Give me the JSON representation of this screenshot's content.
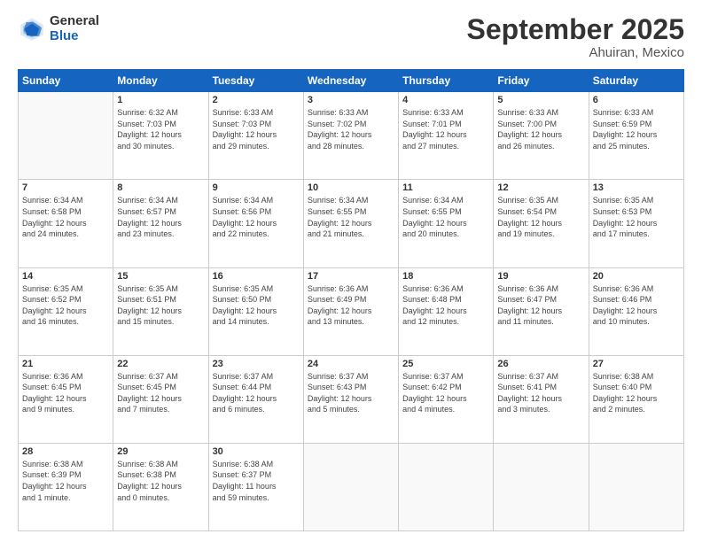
{
  "logo": {
    "general": "General",
    "blue": "Blue"
  },
  "title": {
    "month": "September 2025",
    "location": "Ahuiran, Mexico"
  },
  "days_header": [
    "Sunday",
    "Monday",
    "Tuesday",
    "Wednesday",
    "Thursday",
    "Friday",
    "Saturday"
  ],
  "weeks": [
    [
      {
        "day": "",
        "info": ""
      },
      {
        "day": "1",
        "info": "Sunrise: 6:32 AM\nSunset: 7:03 PM\nDaylight: 12 hours\nand 30 minutes."
      },
      {
        "day": "2",
        "info": "Sunrise: 6:33 AM\nSunset: 7:03 PM\nDaylight: 12 hours\nand 29 minutes."
      },
      {
        "day": "3",
        "info": "Sunrise: 6:33 AM\nSunset: 7:02 PM\nDaylight: 12 hours\nand 28 minutes."
      },
      {
        "day": "4",
        "info": "Sunrise: 6:33 AM\nSunset: 7:01 PM\nDaylight: 12 hours\nand 27 minutes."
      },
      {
        "day": "5",
        "info": "Sunrise: 6:33 AM\nSunset: 7:00 PM\nDaylight: 12 hours\nand 26 minutes."
      },
      {
        "day": "6",
        "info": "Sunrise: 6:33 AM\nSunset: 6:59 PM\nDaylight: 12 hours\nand 25 minutes."
      }
    ],
    [
      {
        "day": "7",
        "info": "Sunrise: 6:34 AM\nSunset: 6:58 PM\nDaylight: 12 hours\nand 24 minutes."
      },
      {
        "day": "8",
        "info": "Sunrise: 6:34 AM\nSunset: 6:57 PM\nDaylight: 12 hours\nand 23 minutes."
      },
      {
        "day": "9",
        "info": "Sunrise: 6:34 AM\nSunset: 6:56 PM\nDaylight: 12 hours\nand 22 minutes."
      },
      {
        "day": "10",
        "info": "Sunrise: 6:34 AM\nSunset: 6:55 PM\nDaylight: 12 hours\nand 21 minutes."
      },
      {
        "day": "11",
        "info": "Sunrise: 6:34 AM\nSunset: 6:55 PM\nDaylight: 12 hours\nand 20 minutes."
      },
      {
        "day": "12",
        "info": "Sunrise: 6:35 AM\nSunset: 6:54 PM\nDaylight: 12 hours\nand 19 minutes."
      },
      {
        "day": "13",
        "info": "Sunrise: 6:35 AM\nSunset: 6:53 PM\nDaylight: 12 hours\nand 17 minutes."
      }
    ],
    [
      {
        "day": "14",
        "info": "Sunrise: 6:35 AM\nSunset: 6:52 PM\nDaylight: 12 hours\nand 16 minutes."
      },
      {
        "day": "15",
        "info": "Sunrise: 6:35 AM\nSunset: 6:51 PM\nDaylight: 12 hours\nand 15 minutes."
      },
      {
        "day": "16",
        "info": "Sunrise: 6:35 AM\nSunset: 6:50 PM\nDaylight: 12 hours\nand 14 minutes."
      },
      {
        "day": "17",
        "info": "Sunrise: 6:36 AM\nSunset: 6:49 PM\nDaylight: 12 hours\nand 13 minutes."
      },
      {
        "day": "18",
        "info": "Sunrise: 6:36 AM\nSunset: 6:48 PM\nDaylight: 12 hours\nand 12 minutes."
      },
      {
        "day": "19",
        "info": "Sunrise: 6:36 AM\nSunset: 6:47 PM\nDaylight: 12 hours\nand 11 minutes."
      },
      {
        "day": "20",
        "info": "Sunrise: 6:36 AM\nSunset: 6:46 PM\nDaylight: 12 hours\nand 10 minutes."
      }
    ],
    [
      {
        "day": "21",
        "info": "Sunrise: 6:36 AM\nSunset: 6:45 PM\nDaylight: 12 hours\nand 9 minutes."
      },
      {
        "day": "22",
        "info": "Sunrise: 6:37 AM\nSunset: 6:45 PM\nDaylight: 12 hours\nand 7 minutes."
      },
      {
        "day": "23",
        "info": "Sunrise: 6:37 AM\nSunset: 6:44 PM\nDaylight: 12 hours\nand 6 minutes."
      },
      {
        "day": "24",
        "info": "Sunrise: 6:37 AM\nSunset: 6:43 PM\nDaylight: 12 hours\nand 5 minutes."
      },
      {
        "day": "25",
        "info": "Sunrise: 6:37 AM\nSunset: 6:42 PM\nDaylight: 12 hours\nand 4 minutes."
      },
      {
        "day": "26",
        "info": "Sunrise: 6:37 AM\nSunset: 6:41 PM\nDaylight: 12 hours\nand 3 minutes."
      },
      {
        "day": "27",
        "info": "Sunrise: 6:38 AM\nSunset: 6:40 PM\nDaylight: 12 hours\nand 2 minutes."
      }
    ],
    [
      {
        "day": "28",
        "info": "Sunrise: 6:38 AM\nSunset: 6:39 PM\nDaylight: 12 hours\nand 1 minute."
      },
      {
        "day": "29",
        "info": "Sunrise: 6:38 AM\nSunset: 6:38 PM\nDaylight: 12 hours\nand 0 minutes."
      },
      {
        "day": "30",
        "info": "Sunrise: 6:38 AM\nSunset: 6:37 PM\nDaylight: 11 hours\nand 59 minutes."
      },
      {
        "day": "",
        "info": ""
      },
      {
        "day": "",
        "info": ""
      },
      {
        "day": "",
        "info": ""
      },
      {
        "day": "",
        "info": ""
      }
    ]
  ]
}
